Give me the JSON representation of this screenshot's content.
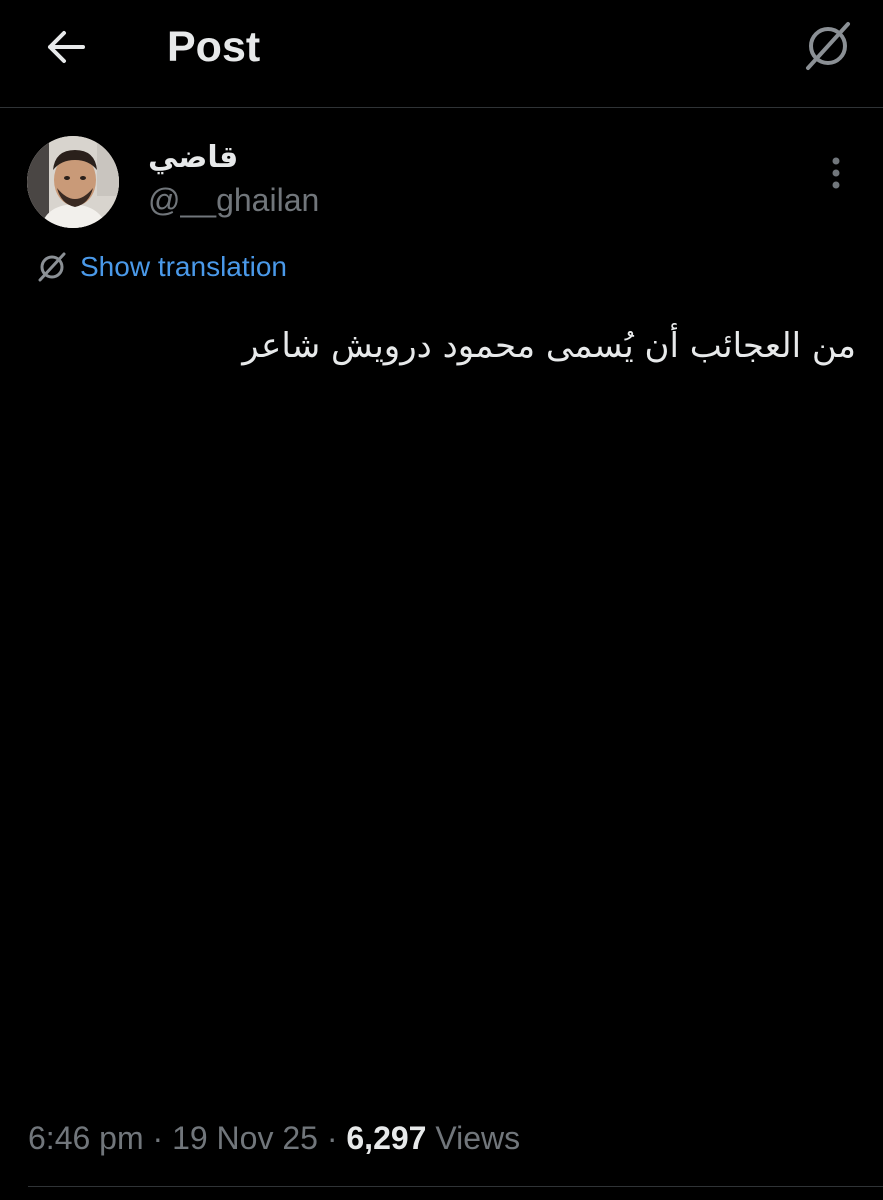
{
  "header": {
    "title": "Post",
    "back_icon": "arrow-left-icon",
    "translate_icon": "translate-globe-icon"
  },
  "post": {
    "author": {
      "display_name": "قاضي",
      "handle": "@__ghailan"
    },
    "show_translation_label": "Show translation",
    "text": "من العجائب أن يُسمى محمود درويش شاعر",
    "time": "6:46 pm",
    "date": "19 Nov 25",
    "separator": " · ",
    "views_count": "6,297",
    "views_label": "Views"
  },
  "colors": {
    "background": "#000000",
    "primary_text": "#e7e9ea",
    "secondary_text": "#71767b",
    "link": "#4a99e9",
    "divider": "#2f3336"
  }
}
